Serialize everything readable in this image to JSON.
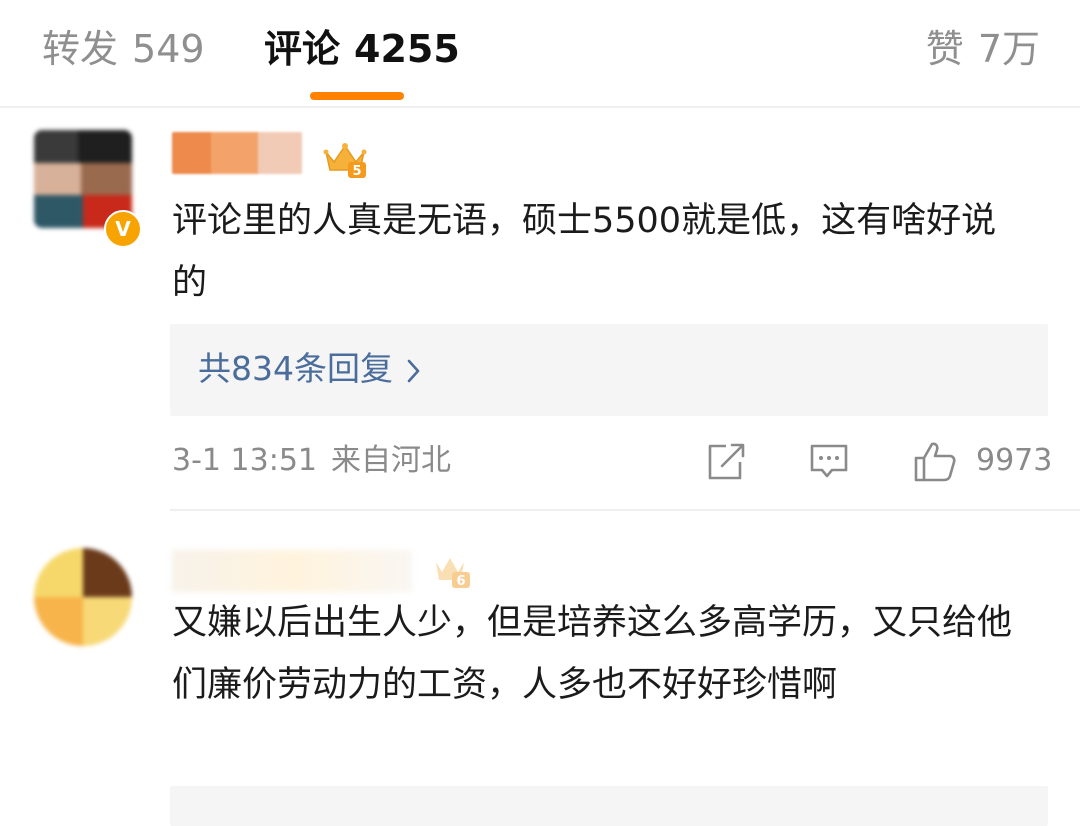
{
  "tabs": {
    "repost": {
      "label": "转发",
      "count": "549"
    },
    "comments": {
      "label": "评论",
      "count": "4255"
    },
    "likes": {
      "label": "赞",
      "count": "7万"
    }
  },
  "colors": {
    "accent": "#ff8200",
    "link": "#4a6d9c",
    "muted": "#8a8a8a"
  },
  "comments": [
    {
      "text": "评论里的人真是无语，硕士5500就是低，这有啥好说的",
      "vip_badge": "V",
      "level_badge": "5",
      "replies_label": "共834条回复",
      "date": "3-1 13:51",
      "location": "来自河北",
      "like_count": "9973",
      "icons": [
        "share-icon",
        "comment-icon",
        "thumbs-up-icon",
        "chevron-right-icon"
      ]
    },
    {
      "text": "又嫌以后出生人少，但是培养这么多高学历，又只给他们廉价劳动力的工资，人多也不好好珍惜啊",
      "level_badge": "6"
    }
  ]
}
